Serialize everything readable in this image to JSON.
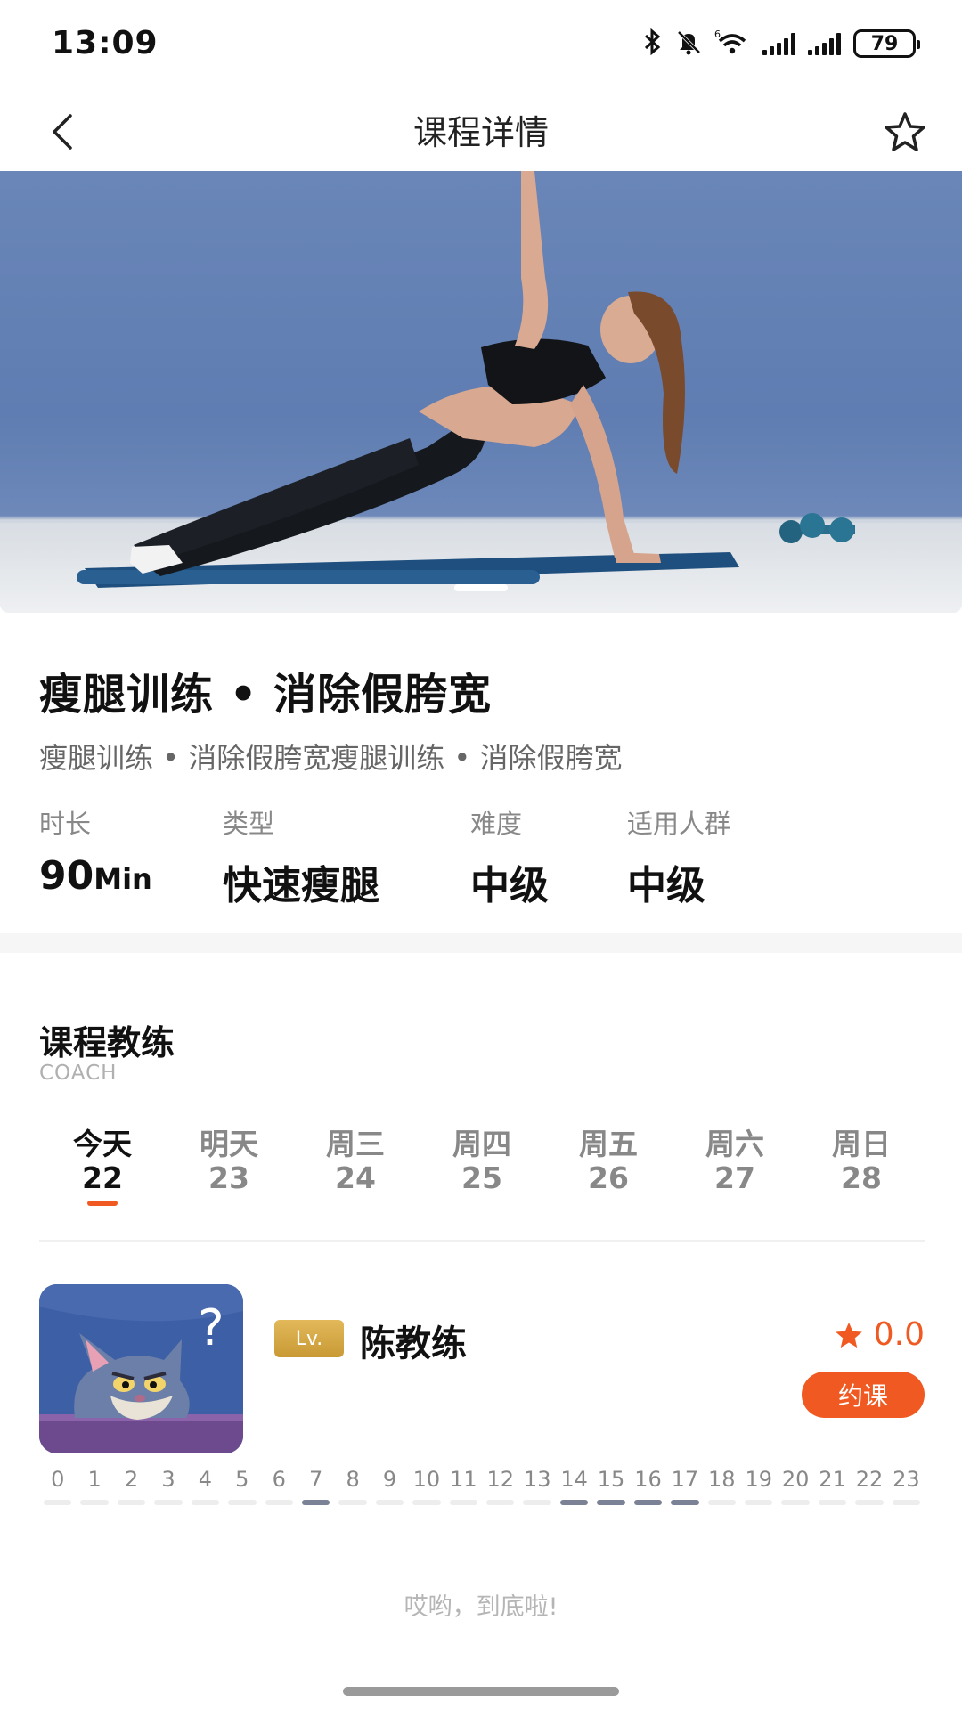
{
  "status_bar": {
    "time": "13:09",
    "battery": "79",
    "network_label": "6",
    "icons": [
      "bluetooth-icon",
      "mute-bell-icon",
      "wifi-icon",
      "signal-icon",
      "signal-icon",
      "battery-icon"
    ]
  },
  "nav": {
    "title": "课程详情",
    "back_icon": "chevron-left-icon",
    "favorite_icon": "star-outline-icon"
  },
  "hero": {
    "image_description": "woman-side-plank-photo",
    "slide_indicator_count": 1
  },
  "course": {
    "title": "瘦腿训练 • 消除假胯宽",
    "subtitle": "瘦腿训练 • 消除假胯宽瘦腿训练 • 消除假胯宽",
    "stats": [
      {
        "label": "时长",
        "value": "90",
        "unit": "Min"
      },
      {
        "label": "类型",
        "value": "快速瘦腿",
        "unit": ""
      },
      {
        "label": "难度",
        "value": "中级",
        "unit": ""
      },
      {
        "label": "适用人群",
        "value": "中级",
        "unit": ""
      }
    ]
  },
  "coach_section": {
    "title": "课程教练",
    "subtitle": "COACH",
    "dates": [
      {
        "day": "今天",
        "date": "22",
        "active": true
      },
      {
        "day": "明天",
        "date": "23",
        "active": false
      },
      {
        "day": "周三",
        "date": "24",
        "active": false
      },
      {
        "day": "周四",
        "date": "25",
        "active": false
      },
      {
        "day": "周五",
        "date": "26",
        "active": false
      },
      {
        "day": "周六",
        "date": "27",
        "active": false
      },
      {
        "day": "周日",
        "date": "28",
        "active": false
      }
    ],
    "accent_color": "#f05a22"
  },
  "coach": {
    "level_badge": "Lv.",
    "name": "陈教练",
    "rating": "0.0",
    "book_label": "约课",
    "avatar_description": "cartoon-cat-avatar",
    "hours": [
      "0",
      "1",
      "2",
      "3",
      "4",
      "5",
      "6",
      "7",
      "8",
      "9",
      "10",
      "11",
      "12",
      "13",
      "14",
      "15",
      "16",
      "17",
      "18",
      "19",
      "20",
      "21",
      "22",
      "23"
    ],
    "available_hours": [
      7,
      14,
      15,
      16,
      17
    ]
  },
  "footer": {
    "end_text": "哎哟，到底啦!"
  }
}
